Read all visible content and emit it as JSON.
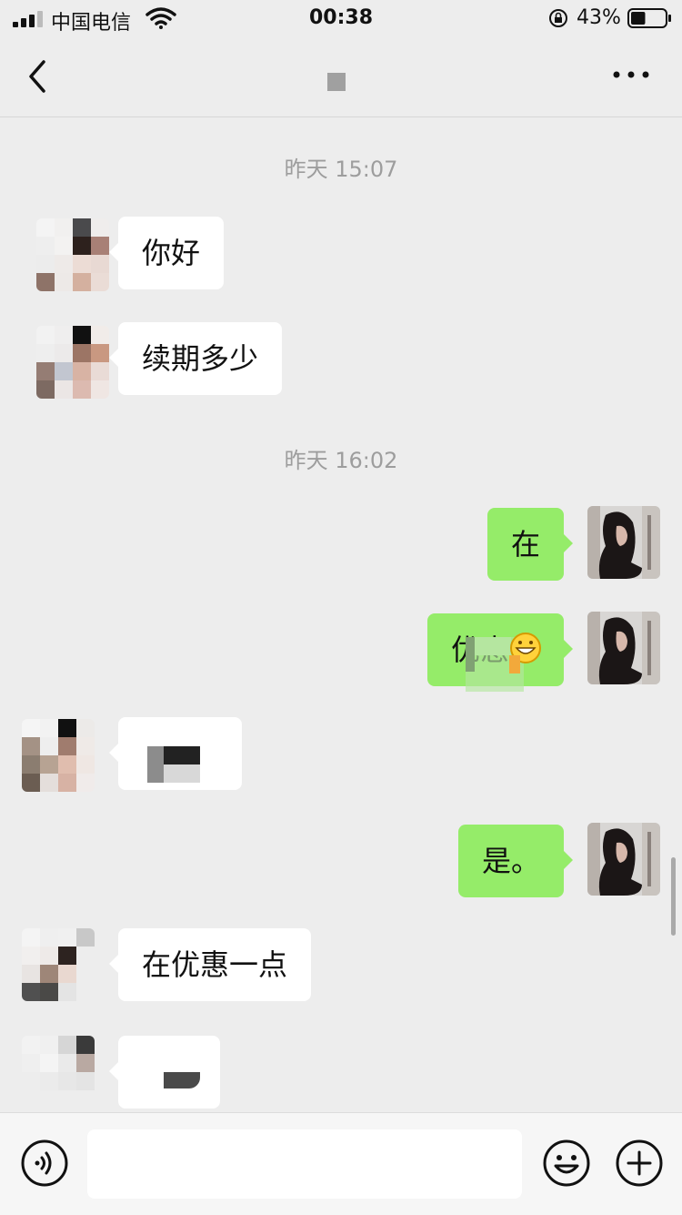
{
  "status_bar": {
    "carrier": "中国电信",
    "time": "00:38",
    "battery_percent": "43%",
    "battery_level": 0.43
  },
  "nav": {
    "title": "",
    "back_icon": "chevron-left-icon",
    "more_icon": "more-dots-icon"
  },
  "messages": {
    "ts1": "昨天 15:07",
    "m1": "你好",
    "m2": "续期多少",
    "ts2": "昨天 16:02",
    "m3": "在",
    "m4": "优惠",
    "m6": "是。",
    "m7": "在优惠一点"
  },
  "input_bar": {
    "placeholder": "",
    "voice_icon": "voice-icon",
    "emoji_icon": "smile-icon",
    "plus_icon": "plus-circle-icon"
  },
  "colors": {
    "background": "#ededed",
    "self_bubble": "#95ec69",
    "other_bubble": "#ffffff",
    "timestamp": "#9d9d9d"
  }
}
